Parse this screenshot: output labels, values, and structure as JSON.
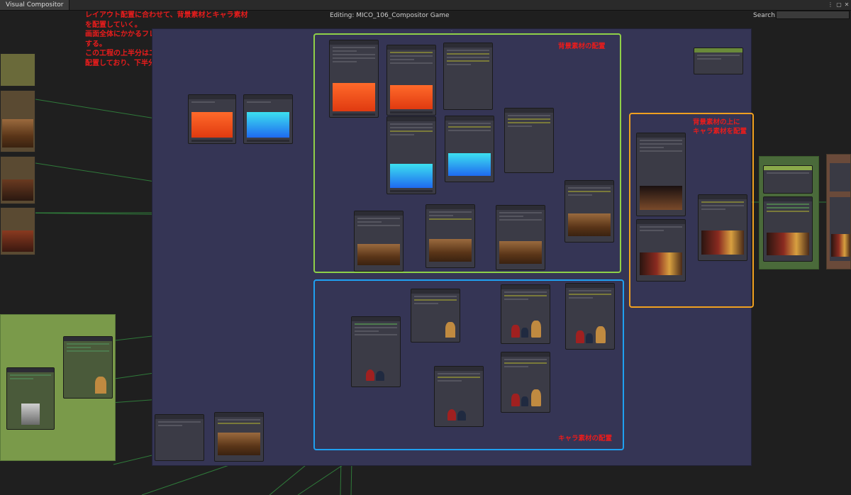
{
  "window": {
    "tab_label": "Visual Compositor",
    "editing": "Editing: MICO_106_Compositor Game",
    "search_label": "Search:",
    "search_value": ""
  },
  "note_text": "レイアウト配置に合わせて、背景素材とキャラ素材\nを配置していく。\n画面全体にかかるフレアなども、この段階で処理を\nする。\nこの工程の上半分はエフェクト等を含む背景素材を\n配置しており、下半分はキャラ素材を配置している。",
  "frames": {
    "background": "背景素材の配置",
    "overlay": "背景素材の上に\nキャラ素材を配置",
    "character": "キャラ素材の配置"
  },
  "colors": {
    "group_bg": "#353555",
    "frame_green": "#8fd048",
    "frame_orange": "#f0a020",
    "frame_blue": "#1fa0f0",
    "note_red": "#e81c1c",
    "wire_green": "#2f7a3a"
  }
}
